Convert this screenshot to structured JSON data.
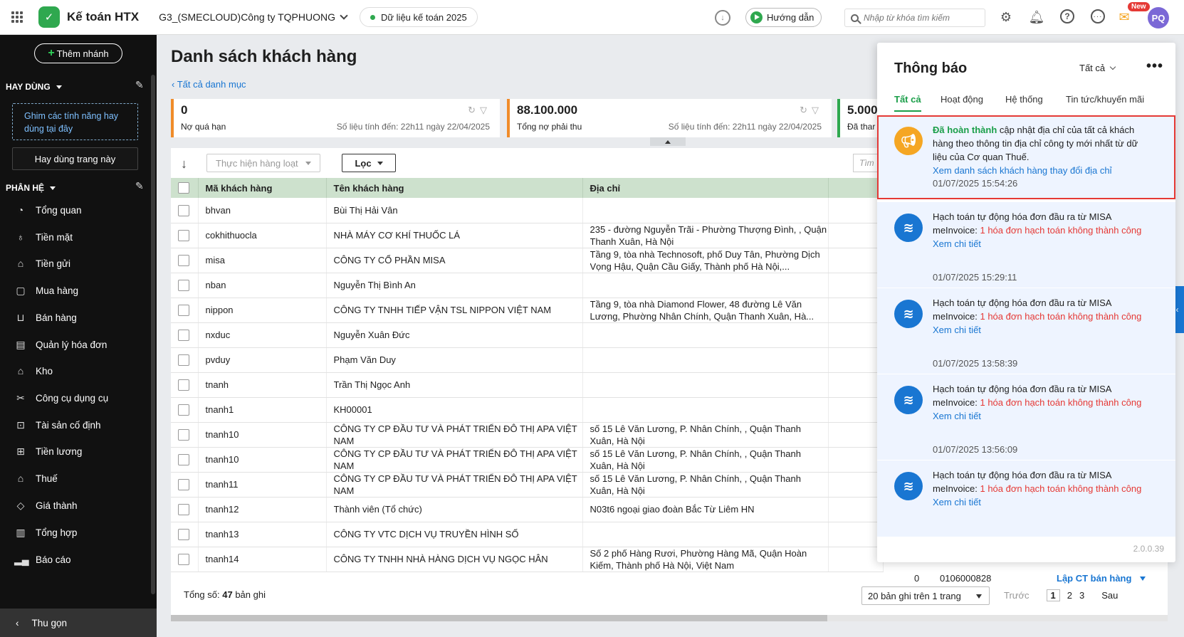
{
  "topbar": {
    "app_name": "Kế toán HTX",
    "company": "G3_(SMECLOUD)Công ty TQPHUONG",
    "data_year": "Dữ liệu kế toán 2025",
    "guide": "Hướng dẫn",
    "search_placeholder": "Nhập từ khóa tìm kiếm",
    "new_badge": "New",
    "avatar": "PQ"
  },
  "sidebar": {
    "add_branch": "Thêm nhánh",
    "favorites_title": "HAY DÙNG",
    "pin_hint": "Ghim các tính năng hay dùng tại đây",
    "pin_button": "Hay dùng trang này",
    "modules_title": "PHÂN HỆ",
    "items": [
      {
        "label": "Tổng quan",
        "icon": "gauge-icon"
      },
      {
        "label": "Tiền mặt",
        "icon": "money-bag-icon"
      },
      {
        "label": "Tiền gửi",
        "icon": "bank-icon"
      },
      {
        "label": "Mua hàng",
        "icon": "shopping-bag-icon"
      },
      {
        "label": "Bán hàng",
        "icon": "cart-icon"
      },
      {
        "label": "Quản lý hóa đơn",
        "icon": "invoice-icon"
      },
      {
        "label": "Kho",
        "icon": "warehouse-icon"
      },
      {
        "label": "Công cụ dụng cụ",
        "icon": "tools-icon"
      },
      {
        "label": "Tài sản cố định",
        "icon": "car-icon"
      },
      {
        "label": "Tiền lương",
        "icon": "salary-icon"
      },
      {
        "label": "Thuế",
        "icon": "tax-icon"
      },
      {
        "label": "Giá thành",
        "icon": "price-tag-icon"
      },
      {
        "label": "Tổng hợp",
        "icon": "ledger-icon"
      },
      {
        "label": "Báo cáo",
        "icon": "report-chart-icon"
      }
    ],
    "collapse": "Thu gọn"
  },
  "main": {
    "title": "Danh sách khách hàng",
    "back_link": "Tất cả danh mục",
    "cards": [
      {
        "value": "0",
        "label": "Nợ quá hạn",
        "asof": "Số liệu tính đến: 22h11 ngày 22/04/2025"
      },
      {
        "value": "88.100.000",
        "label": "Tổng nợ phải thu",
        "asof": "Số liệu tính đến: 22h11 ngày 22/04/2025"
      },
      {
        "value": "5.000",
        "label": "Đã thar"
      }
    ],
    "bulk_action": "Thực hiện hàng loạt",
    "filter": "Lọc",
    "grid_search_placeholder": "Tìm",
    "columns": [
      "Mã khách hàng",
      "Tên khách hàng",
      "Địa chỉ"
    ],
    "rows": [
      {
        "code": "bhvan",
        "name": "Bùi Thị Hải Vân",
        "address": ""
      },
      {
        "code": "cokhithuocla",
        "name": "NHÀ MÁY CƠ KHÍ THUỐC LÁ",
        "address": "235 - đường Nguyễn Trãi - Phường Thượng Đình, , Quận Thanh Xuân, Hà Nội"
      },
      {
        "code": "misa",
        "name": "CÔNG TY CỔ PHẦN MISA",
        "address": "Tầng 9, tòa nhà Technosoft, phố Duy Tân, Phường Dịch Vọng Hậu, Quận Cầu Giấy, Thành phố Hà Nội,..."
      },
      {
        "code": "nban",
        "name": "Nguyễn Thị Bình An",
        "address": ""
      },
      {
        "code": "nippon",
        "name": "CÔNG TY TNHH TIẾP VẬN TSL NIPPON VIỆT NAM",
        "address": "Tầng 9, tòa nhà Diamond Flower, 48 đường Lê Văn Lương, Phường Nhân Chính, Quận Thanh Xuân, Hà..."
      },
      {
        "code": "nxduc",
        "name": "Nguyễn Xuân Đức",
        "address": ""
      },
      {
        "code": "pvduy",
        "name": "Phạm Văn Duy",
        "address": ""
      },
      {
        "code": "tnanh",
        "name": "Trần Thị Ngọc Anh",
        "address": ""
      },
      {
        "code": "tnanh1",
        "name": "KH00001",
        "address": ""
      },
      {
        "code": "tnanh10",
        "name": "CÔNG TY CP ĐẦU TƯ VÀ PHÁT TRIỂN ĐÔ THỊ APA VIỆT NAM",
        "address": "số 15 Lê Văn Lương, P. Nhân Chính, , Quận Thanh Xuân, Hà Nội"
      },
      {
        "code": "tnanh10",
        "name": "CÔNG TY CP ĐẦU TƯ VÀ PHÁT TRIỂN ĐÔ THỊ APA VIỆT NAM",
        "address": "số 15 Lê Văn Lương, P. Nhân Chính, , Quận Thanh Xuân, Hà Nội"
      },
      {
        "code": "tnanh11",
        "name": "CÔNG TY CP ĐẦU TƯ VÀ PHÁT TRIỂN ĐÔ THỊ APA VIỆT NAM",
        "address": "số 15 Lê Văn Lương, P. Nhân Chính, , Quận Thanh Xuân, Hà Nội"
      },
      {
        "code": "tnanh12",
        "name": "Thành viên (Tổ chức)",
        "address": "N03t6 ngoại giao đoàn Bắc Từ Liêm HN"
      },
      {
        "code": "tnanh13",
        "name": "CÔNG TY VTC DỊCH VỤ TRUYỀN HÌNH SỐ",
        "address": ""
      },
      {
        "code": "tnanh14",
        "name": "CÔNG TY TNHH NHÀ HÀNG DỊCH VỤ NGỌC HÂN",
        "address": "Số 2 phố Hàng Rươi, Phường Hàng Mã, Quận Hoàn Kiếm, Thành phố Hà Nội, Việt Nam"
      }
    ],
    "last_row_extra": {
      "amount": "0",
      "tax_code": "0106000828",
      "action": "Lập CT bán hàng"
    },
    "footer": {
      "total_label": "Tổng số:",
      "total_count": "47",
      "total_unit": "bản ghi",
      "page_size": "20 bản ghi trên 1 trang",
      "prev": "Trước",
      "pages": [
        "1",
        "2",
        "3"
      ],
      "next": "Sau"
    }
  },
  "notifications": {
    "title": "Thông báo",
    "filter": "Tất cả",
    "tabs": [
      "Tất cả",
      "Hoạt động",
      "Hệ thống",
      "Tin tức/khuyến mãi"
    ],
    "first": {
      "status": "Đã hoàn thành",
      "text": " cập nhật địa chỉ của tất cả khách hàng theo thông tin địa chỉ công ty mới nhất từ dữ liệu của Cơ quan Thuế.",
      "link": "Xem danh sách khách hàng thay đổi địa chỉ",
      "time": "01/07/2025 15:54:26"
    },
    "items": [
      {
        "text": "Hạch toán tự động hóa đơn đầu ra từ MISA meInvoice: ",
        "error": "1 hóa đơn hạch toán không thành công",
        "link": "Xem chi tiết",
        "time": "01/07/2025 15:29:11"
      },
      {
        "text": "Hạch toán tự động hóa đơn đầu ra từ MISA meInvoice: ",
        "error": "1 hóa đơn hạch toán không thành công",
        "link": "Xem chi tiết",
        "time": "01/07/2025 13:58:39"
      },
      {
        "text": "Hạch toán tự động hóa đơn đầu ra từ MISA meInvoice: ",
        "error": "1 hóa đơn hạch toán không thành công",
        "link": "Xem chi tiết",
        "time": "01/07/2025 13:56:09"
      },
      {
        "text": "Hạch toán tự động hóa đơn đầu ra từ MISA meInvoice: ",
        "error": "1 hóa đơn hạch toán không thành công",
        "link": "Xem chi tiết",
        "time": ""
      }
    ],
    "version": "2.0.0.39"
  }
}
